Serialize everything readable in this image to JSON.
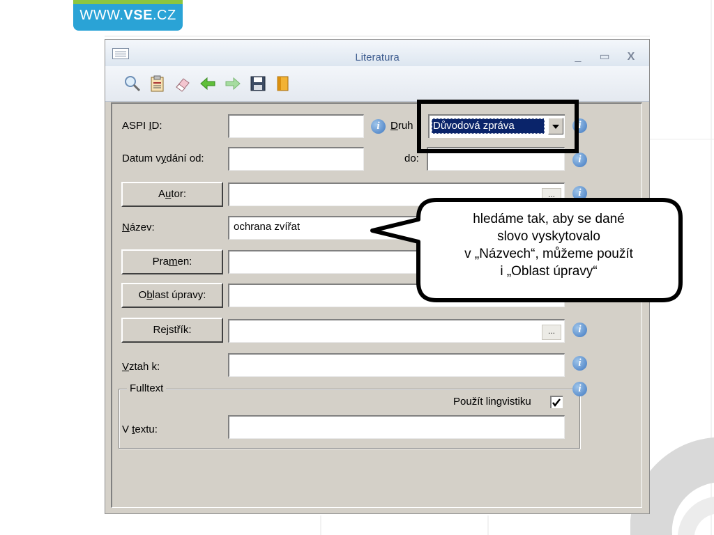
{
  "logo": {
    "prefix": "WWW.",
    "brand": "VSE",
    "suffix": ".CZ"
  },
  "window": {
    "title": "Literatura",
    "controls": {
      "minimize": "_",
      "maximize": "▭",
      "close": "X"
    }
  },
  "toolbar": {
    "items": [
      "search-icon",
      "clipboard-icon",
      "eraser-icon",
      "back-arrow-icon",
      "forward-arrow-icon",
      "save-icon",
      "book-icon"
    ]
  },
  "form": {
    "aspi_id": {
      "label_pre": "ASPI ",
      "label_key": "I",
      "label_post": "D:",
      "value": ""
    },
    "druh": {
      "label_pre": "",
      "label_key": "D",
      "label_post": "ruh",
      "selected": "Důvodová zpráva"
    },
    "datum_od": {
      "label_pre": "Datum v",
      "label_key": "y",
      "label_post": "dání  od:",
      "value": ""
    },
    "datum_do": {
      "label": "do:",
      "value": ""
    },
    "autor": {
      "label_pre": "A",
      "label_key": "u",
      "label_post": "tor:",
      "value": ""
    },
    "nazev": {
      "label_pre": "",
      "label_key": "N",
      "label_post": "ázev:",
      "value": "ochrana zvířat"
    },
    "pramen": {
      "label_pre": "Pra",
      "label_key": "m",
      "label_post": "en:",
      "value": ""
    },
    "oblast": {
      "label_pre": "O",
      "label_key": "b",
      "label_post": "last úpravy:",
      "value": ""
    },
    "rejstrik": {
      "label_pre": "Re",
      "label_key": "j",
      "label_post": "střík:",
      "value": "",
      "browse": "..."
    },
    "vztah": {
      "label_pre": "",
      "label_key": "V",
      "label_post": "ztah k:",
      "value": ""
    },
    "fulltext": {
      "group_title": "Fulltext",
      "lingvistika_label": "Použít lingvistiku",
      "lingvistika_checked": true,
      "v_textu": {
        "label_pre": "V ",
        "label_key": "t",
        "label_post": "extu:",
        "value": ""
      }
    },
    "info_glyph": "i"
  },
  "callout": {
    "lines": [
      "hledáme tak, aby se dané",
      "slovo vyskytovalo",
      "v „Názvech“, můžeme použít",
      "i „Oblast úpravy“"
    ]
  },
  "colors": {
    "logo": "#2aa3d6",
    "logo_strip": "#8cc63f",
    "window_bg": "#d4d0c8",
    "selection": "#0a246a",
    "title_text": "#3d5c8f"
  }
}
